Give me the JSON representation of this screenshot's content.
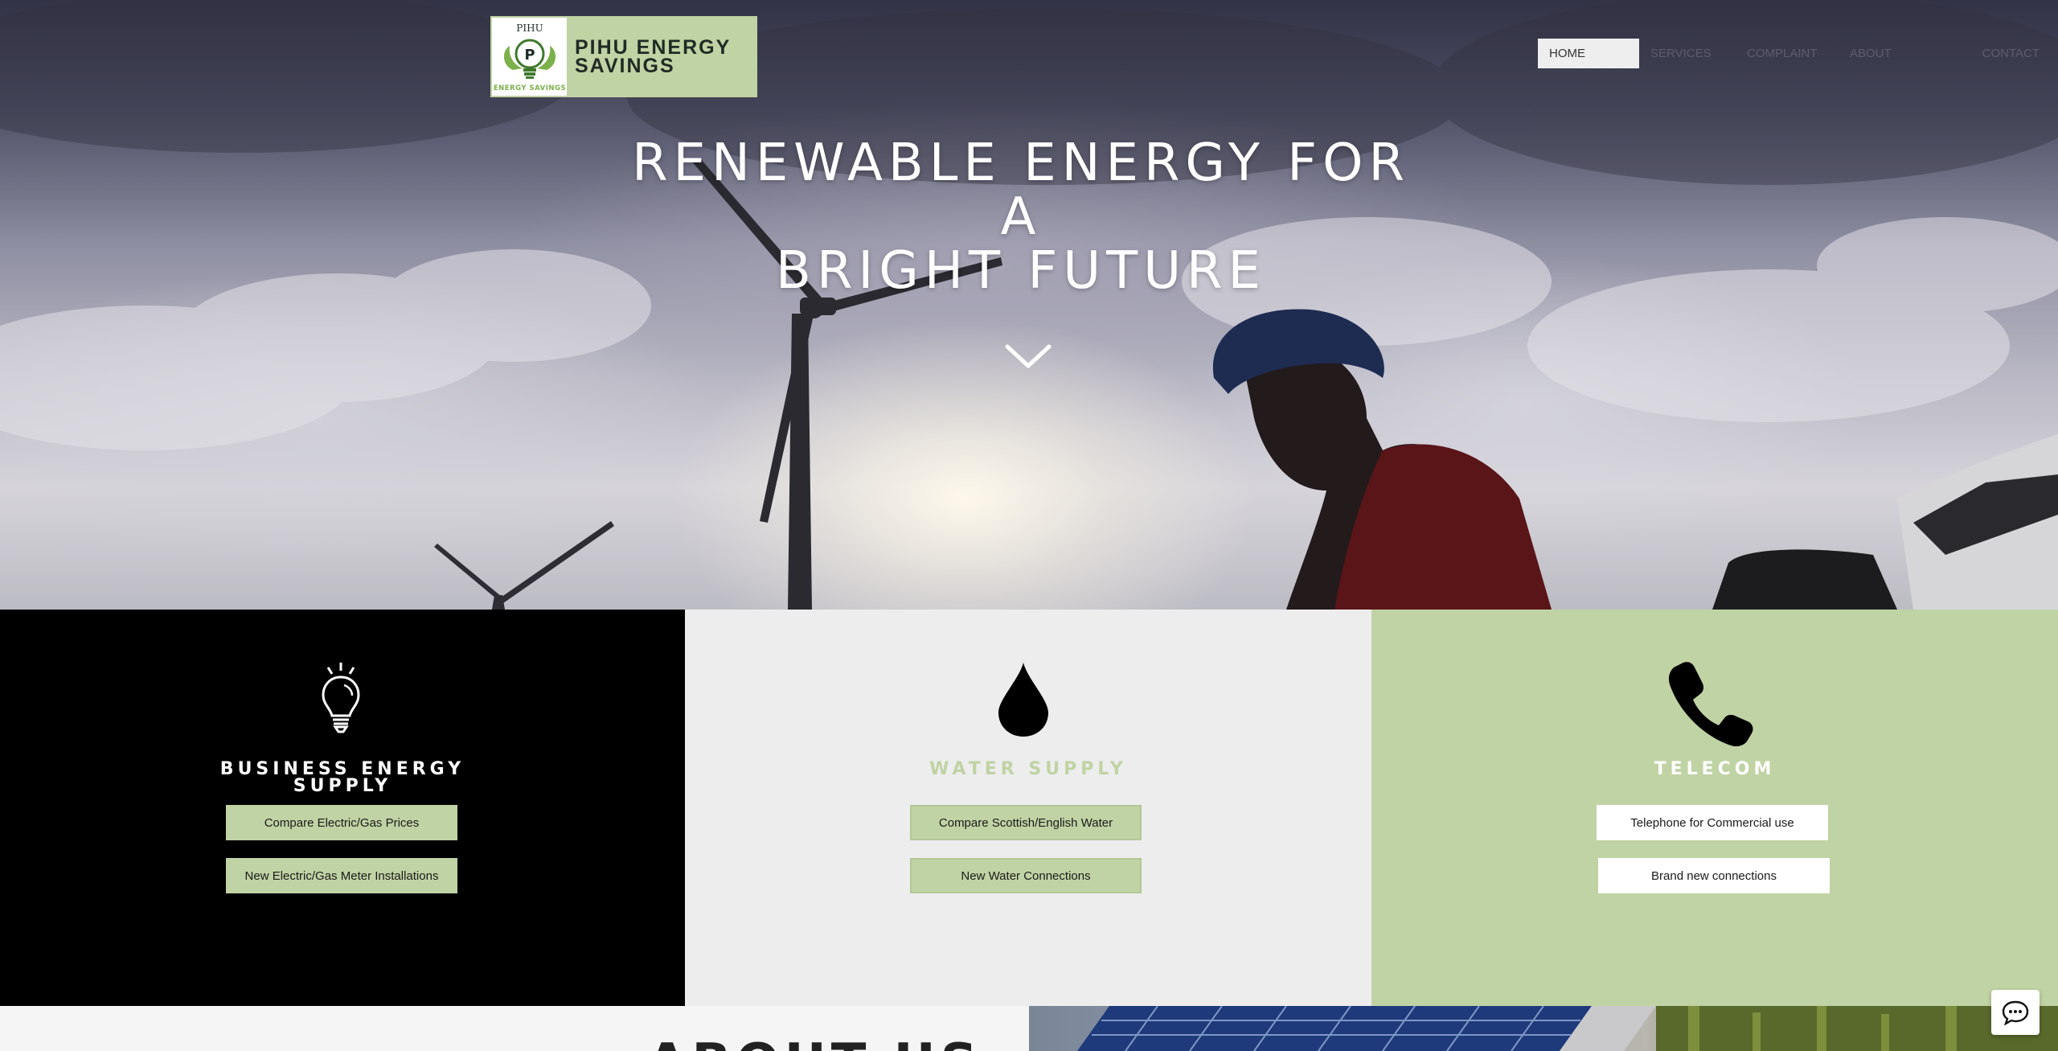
{
  "brand": {
    "logo_top_text": "PIHU",
    "logo_letter": "P",
    "logo_bottom_text": "ENERGY SAVINGS",
    "name_line1": "PIHU ENERGY",
    "name_line2": "SAVINGS",
    "accent_color": "#c0d3a4"
  },
  "nav": {
    "items": [
      {
        "label": "HOME",
        "active": true
      },
      {
        "label": "SERVICES",
        "active": false
      },
      {
        "label": "COMPLAINT",
        "active": false
      },
      {
        "label": "ABOUT",
        "active": false
      },
      {
        "label": "CONTACT",
        "active": false
      }
    ]
  },
  "hero": {
    "title_line1": "RENEWABLE ENERGY FOR",
    "title_line2": "A",
    "title_line3": "BRIGHT FUTURE",
    "scroll_icon": "chevron-down-icon"
  },
  "services": {
    "business": {
      "icon": "lightbulb-icon",
      "title_line1": "BUSINESS ENERGY",
      "title_line2": "SUPPLY",
      "buttons": [
        "Compare Electric/Gas Prices",
        "New Electric/Gas Meter Installations"
      ]
    },
    "water": {
      "icon": "water-drop-icon",
      "title": "WATER SUPPLY",
      "buttons": [
        "Compare Scottish/English Water",
        "New Water Connections"
      ]
    },
    "telecom": {
      "icon": "phone-icon",
      "title": "TELECOM",
      "buttons": [
        "Telephone for Commercial use",
        "Brand new connections"
      ]
    }
  },
  "about": {
    "heading": "ABOUT US"
  },
  "chat": {
    "icon": "chat-bubble-icon"
  }
}
